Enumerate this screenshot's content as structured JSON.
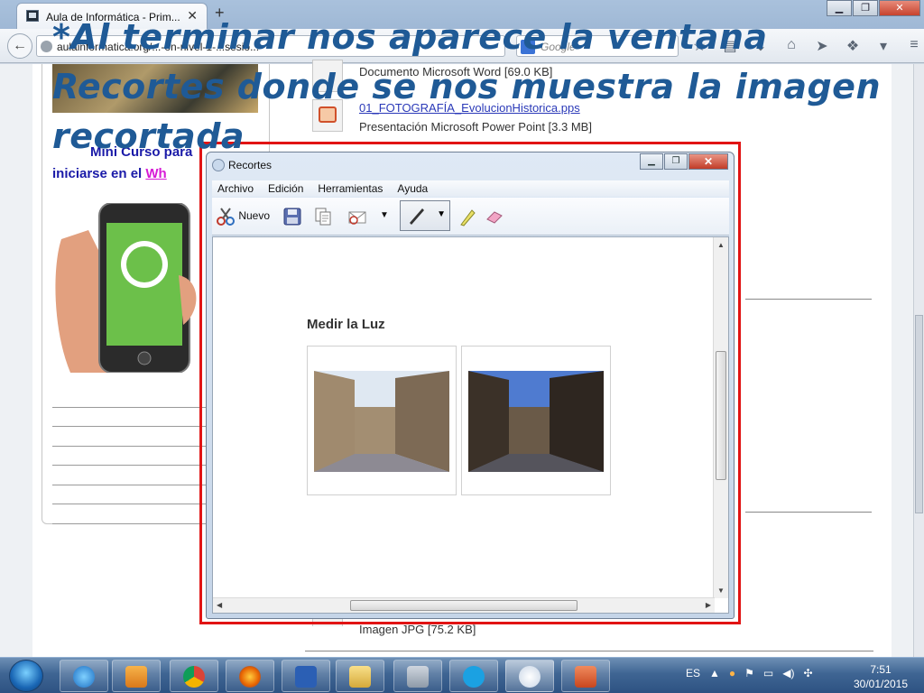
{
  "browser": {
    "tab_title": "Aula de Informática - Prim...",
    "tab_close": "✕",
    "new_tab": "+",
    "url_text": "aulainformatica.org/...-ón-nivel-1-...sesio...",
    "search_placeholder": "Google",
    "window_min": "▁",
    "window_max": "❐",
    "window_close": "✕"
  },
  "page": {
    "course_line1": "Mini Curso para",
    "course_line2_prefix": "iniciarse en el ",
    "course_line2_highlight": "Wh",
    "files": [
      {
        "desc": "Documento Microsoft Word [69.0 KB]"
      },
      {
        "link": "01_FOTOGRAFÍA_EvolucionHistorica.pps",
        "desc": "Presentación Microsoft Power Point [3.3 MB]"
      },
      {
        "desc": "Imagen JPG [75.2 KB]"
      }
    ]
  },
  "caption": {
    "text": "*Al terminar nos aparece la ventana Recortes donde se nos muestra la imagen recortada"
  },
  "snipping_tool": {
    "title": "Recortes",
    "menu": [
      "Archivo",
      "Edición",
      "Herramientas",
      "Ayuda"
    ],
    "new_label": "Nuevo",
    "content_heading": "Medir la Luz",
    "highlight_color": "#e11414"
  },
  "taskbar": {
    "language": "ES",
    "time": "7:51",
    "date": "30/01/2015",
    "apps": [
      "internet-explorer",
      "media-player",
      "chrome",
      "firefox",
      "word",
      "file-explorer",
      "calculator",
      "skype",
      "snipping-tool",
      "presentation"
    ]
  }
}
